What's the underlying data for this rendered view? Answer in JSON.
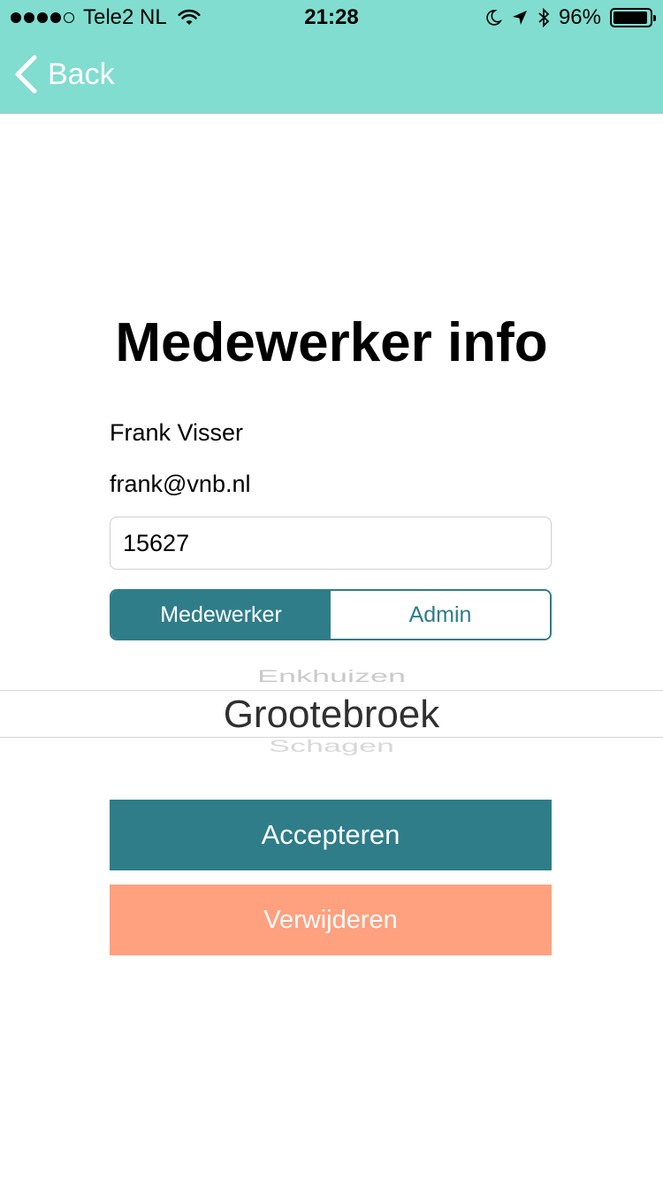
{
  "status_bar": {
    "carrier": "Tele2 NL",
    "time": "21:28",
    "battery": "96%",
    "battery_level": 0.96,
    "icons": [
      "signal-dots",
      "wifi-icon",
      "moon-icon",
      "location-arrow-icon",
      "bluetooth-icon",
      "battery-icon"
    ]
  },
  "nav": {
    "back_label": "Back",
    "color": "#80ddd0"
  },
  "page": {
    "title": "Medewerker info"
  },
  "employee": {
    "name": "Frank Visser",
    "email": "frank@vnb.nl",
    "number": "15627"
  },
  "role_segment": {
    "options": [
      "Medewerker",
      "Admin"
    ],
    "selected": "Medewerker"
  },
  "location_picker": {
    "previous": "Enkhuizen",
    "selected": "Grootebroek",
    "next": "Schagen"
  },
  "actions": {
    "accept_label": "Accepteren",
    "delete_label": "Verwijderen"
  },
  "colors": {
    "accent": "#2e7d89",
    "delete": "#ffa07e",
    "header": "#80ddd0"
  }
}
